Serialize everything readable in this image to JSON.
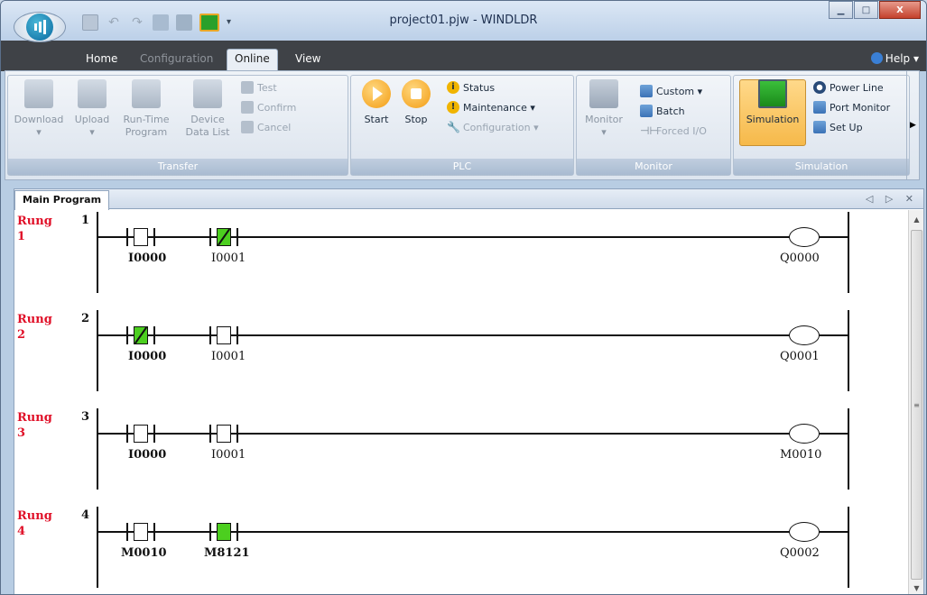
{
  "window": {
    "title": "project01.pjw - WINDLDR",
    "min": "▁",
    "max": "□",
    "close": "X"
  },
  "tabs": {
    "home": "Home",
    "configuration": "Configuration",
    "online": "Online",
    "view": "View",
    "help": "Help ▾"
  },
  "ribbon": {
    "transfer": {
      "label": "Transfer",
      "download": "Download",
      "upload": "Upload",
      "runtime": "Run-Time\nProgram",
      "device": "Device\nData List",
      "test": "Test",
      "confirm": "Confirm",
      "cancel": "Cancel"
    },
    "plc": {
      "label": "PLC",
      "start": "Start",
      "stop": "Stop",
      "status": "Status",
      "maintenance": "Maintenance ▾",
      "configuration": "Configuration ▾"
    },
    "monitor": {
      "label": "Monitor",
      "monitor": "Monitor",
      "custom": "Custom ▾",
      "batch": "Batch",
      "forced": "Forced I/O"
    },
    "simulation": {
      "label": "Simulation",
      "simulation": "Simulation",
      "powerline": "Power Line",
      "portmonitor": "Port Monitor",
      "setup": "Set Up"
    }
  },
  "doc": {
    "tab": "Main Program",
    "nav": "◁ ▷ ✕"
  },
  "rungs": [
    {
      "label": "Rung\n1",
      "num": "1",
      "c1": "I0000",
      "c2": "I0001",
      "coil": "Q0000"
    },
    {
      "label": "Rung\n2",
      "num": "2",
      "c1": "I0000",
      "c2": "I0001",
      "coil": "Q0001"
    },
    {
      "label": "Rung\n3",
      "num": "3",
      "c1": "I0000",
      "c2": "I0001",
      "coil": "M0010"
    },
    {
      "label": "Rung\n4",
      "num": "4",
      "c1": "M0010",
      "c2": "M8121",
      "coil": "Q0002"
    }
  ],
  "colors": {
    "energized": "#4ccf1f",
    "rung_label": "#e01028"
  }
}
